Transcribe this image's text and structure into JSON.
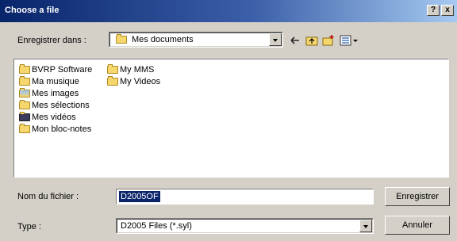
{
  "titlebar": {
    "title": "Choose a file",
    "help_label": "?",
    "close_label": "x"
  },
  "location": {
    "label": "Enregistrer dans :",
    "value": "Mes documents"
  },
  "files": [
    {
      "name": "BVRP Software",
      "icon": "folder-icon"
    },
    {
      "name": "Ma musique",
      "icon": "music-folder-icon"
    },
    {
      "name": "Mes images",
      "icon": "pictures-folder-icon"
    },
    {
      "name": "Mes sélections",
      "icon": "folder-icon"
    },
    {
      "name": "Mes vidéos",
      "icon": "video-folder-icon"
    },
    {
      "name": "Mon bloc-notes",
      "icon": "folder-icon"
    },
    {
      "name": "My MMS",
      "icon": "folder-icon"
    },
    {
      "name": "My Videos",
      "icon": "folder-icon"
    }
  ],
  "filename": {
    "label": "Nom du fichier :",
    "value": "D2005OF"
  },
  "filetype": {
    "label": "Type :",
    "value": "D2005 Files (*.syl)"
  },
  "buttons": {
    "save": "Enregistrer",
    "cancel": "Annuler"
  }
}
